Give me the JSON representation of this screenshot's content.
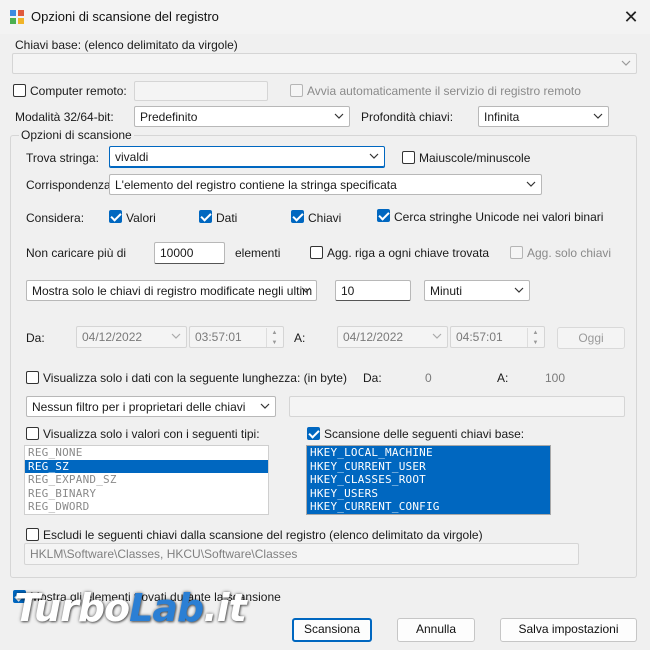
{
  "window": {
    "title": "Opzioni di scansione del registro",
    "close_glyph": "✕"
  },
  "base_keys": {
    "label": "Chiavi base:  (elenco delimitato da virgole)",
    "value": ""
  },
  "remote": {
    "label": "Computer remoto:",
    "value": "",
    "auto_service_label": "Avvia automaticamente il servizio di registro remoto"
  },
  "mode": {
    "label": "Modalità 32/64-bit:",
    "value": "Predefinito"
  },
  "depth": {
    "label": "Profondità chiavi:",
    "value": "Infinita"
  },
  "scan_group": {
    "title": "Opzioni di scansione"
  },
  "find": {
    "label": "Trova stringa:",
    "value": "vivaldi",
    "case_label": "Maiuscole/minuscole"
  },
  "match": {
    "label": "Corrispondenza:",
    "value": "L'elemento del registro contiene la stringa specificata"
  },
  "consider": {
    "label": "Considera:",
    "values": "Valori",
    "data": "Dati",
    "keys": "Chiavi",
    "unicode": "Cerca stringhe Unicode nei valori binari"
  },
  "limit": {
    "label": "Non caricare più di",
    "value": "10000",
    "unit": "elementi",
    "add_row_label": "Agg. riga a ogni chiave trovata",
    "add_only_label": "Agg. solo chiavi"
  },
  "modified": {
    "filter": "Mostra solo le chiavi di registro modificate negli ultim",
    "amount": "10",
    "unit": "Minuti"
  },
  "range": {
    "from_label": "Da:",
    "from_date": "04/12/2022",
    "from_time": "03:57:01",
    "to_label": "A:",
    "to_date": "04/12/2022",
    "to_time": "04:57:01",
    "today_label": "Oggi"
  },
  "length": {
    "label": "Visualizza solo i dati con la seguente lunghezza: (in byte)",
    "from_label": "Da:",
    "from_value": "0",
    "to_label": "A:",
    "to_value": "100"
  },
  "owner": {
    "value": "Nessun filtro per i proprietari delle chiavi",
    "field": ""
  },
  "types": {
    "label": "Visualizza solo i valori con i seguenti tipi:",
    "items": [
      "REG_NONE",
      "REG_SZ",
      "REG_EXPAND_SZ",
      "REG_BINARY",
      "REG_DWORD"
    ]
  },
  "scan_keys": {
    "label": "Scansione delle seguenti chiavi base:",
    "items": [
      "HKEY_LOCAL_MACHINE",
      "HKEY_CURRENT_USER",
      "HKEY_CLASSES_ROOT",
      "HKEY_USERS",
      "HKEY_CURRENT_CONFIG"
    ]
  },
  "exclude": {
    "label": "Escludi le seguenti chiavi dalla scansione del registro (elenco delimitato da virgole)",
    "value": "HKLM\\Software\\Classes, HKCU\\Software\\Classes"
  },
  "show_found": {
    "label": "Mostra gli elementi trovati durante la scansione"
  },
  "buttons": {
    "scan": "Scansiona",
    "cancel": "Annulla",
    "save": "Salva impostazioni"
  },
  "watermark": {
    "part1": "Turbo",
    "part2": "Lab",
    "part3": ".it"
  },
  "colors": {
    "accent": "#0067c0",
    "background": "#f0f0f0"
  }
}
